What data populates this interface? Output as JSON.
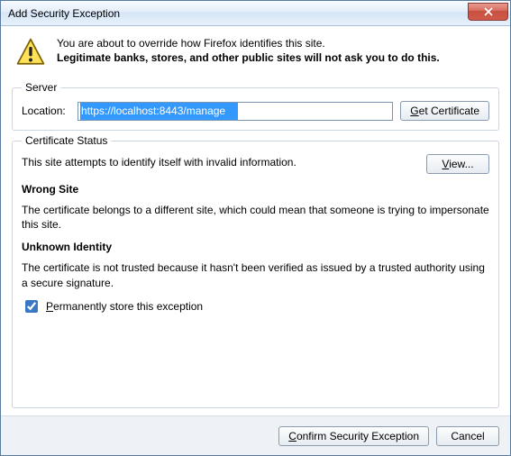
{
  "window": {
    "title": "Add Security Exception"
  },
  "intro": {
    "line1": "You are about to override how Firefox identifies this site.",
    "line2": "Legitimate banks, stores, and other public sites will not ask you to do this."
  },
  "server": {
    "legend": "Server",
    "location_label": "Location:",
    "location_value": "https://localhost:8443/manage",
    "get_cert_label_pre": "G",
    "get_cert_label_rest": "et Certificate"
  },
  "cert": {
    "legend": "Certificate Status",
    "summary": "This site attempts to identify itself with invalid information.",
    "view_label_pre": "V",
    "view_label_rest": "iew...",
    "wrong_site_head": "Wrong Site",
    "wrong_site_body": "The certificate belongs to a different site, which could mean that someone is trying to impersonate this site.",
    "unknown_head": "Unknown Identity",
    "unknown_body": "The certificate is not trusted because it hasn't been verified as issued by a trusted authority using a secure signature."
  },
  "permanent": {
    "label_pre": "P",
    "label_rest": "ermanently store this exception",
    "checked": true
  },
  "footer": {
    "confirm_pre": "C",
    "confirm_rest": "onfirm Security Exception",
    "cancel": "Cancel"
  }
}
